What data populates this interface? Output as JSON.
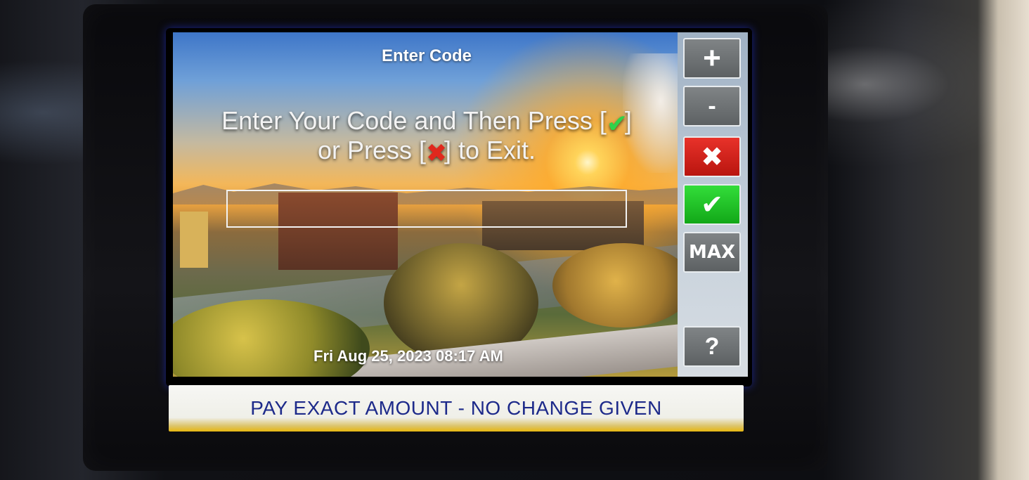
{
  "screen": {
    "title": "Enter Code",
    "instruction_line1_prefix": "Enter Your Code and Then Press [",
    "instruction_line1_suffix": "]",
    "instruction_line2_prefix": "or Press [",
    "instruction_line2_suffix": "] to Exit.",
    "code_value": "",
    "datetime": "Fri Aug 25, 2023 08:17 AM"
  },
  "keypad": {
    "plus": "+",
    "minus": "-",
    "cancel": "✖",
    "enter": "✔",
    "max": "MAX",
    "help": "?"
  },
  "sign": {
    "text": "PAY EXACT AMOUNT - NO CHANGE GIVEN"
  },
  "colors": {
    "accent_red": "#e0281d",
    "accent_green": "#2fd24a",
    "sign_text": "#1d2a8a"
  },
  "icons": [
    "check-icon",
    "x-icon"
  ]
}
